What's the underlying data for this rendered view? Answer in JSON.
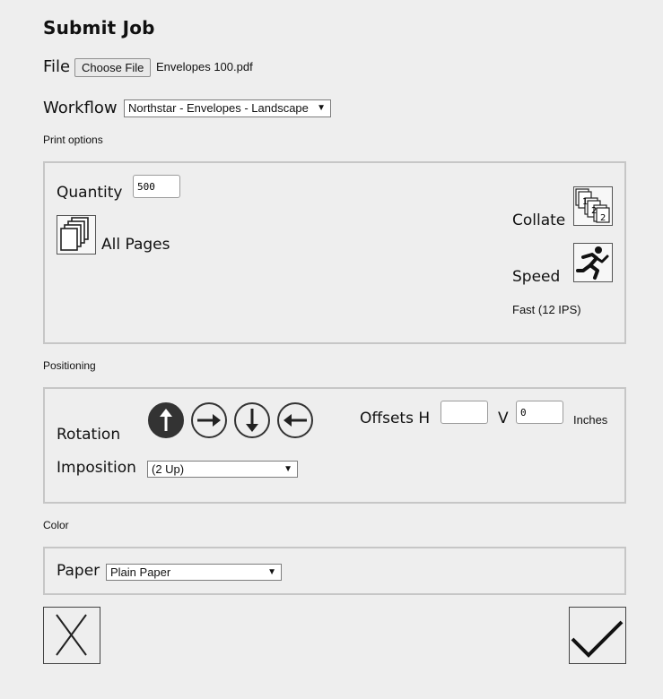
{
  "header": {
    "title": "Submit Job"
  },
  "file": {
    "label": "File",
    "button_label": "Choose File",
    "filename": "Envelopes 100.pdf"
  },
  "workflow": {
    "label": "Workflow",
    "selected": "Northstar - Envelopes - Landscape"
  },
  "print_options": {
    "section_label": "Print options",
    "quantity_label": "Quantity",
    "quantity_value": "500",
    "pages_label": "All Pages",
    "collate_label": "Collate",
    "speed_label": "Speed",
    "speed_value": "Fast (12 IPS)"
  },
  "positioning": {
    "section_label": "Positioning",
    "rotation_label": "Rotation",
    "rotation_selected": "up",
    "offsets_label": "Offsets H",
    "offset_h_value": "",
    "v_label": "V",
    "offset_v_value": "0",
    "units_label": "Inches",
    "imposition_label": "Imposition",
    "imposition_selected": "(2 Up)"
  },
  "color": {
    "section_label": "Color",
    "paper_label": "Paper",
    "paper_selected": "Plain Paper"
  },
  "icons": {
    "collate": "collate-icon",
    "speed": "speed-runner-icon",
    "pages": "pages-stack-icon",
    "cancel": "close-x-icon",
    "confirm": "checkmark-icon"
  }
}
